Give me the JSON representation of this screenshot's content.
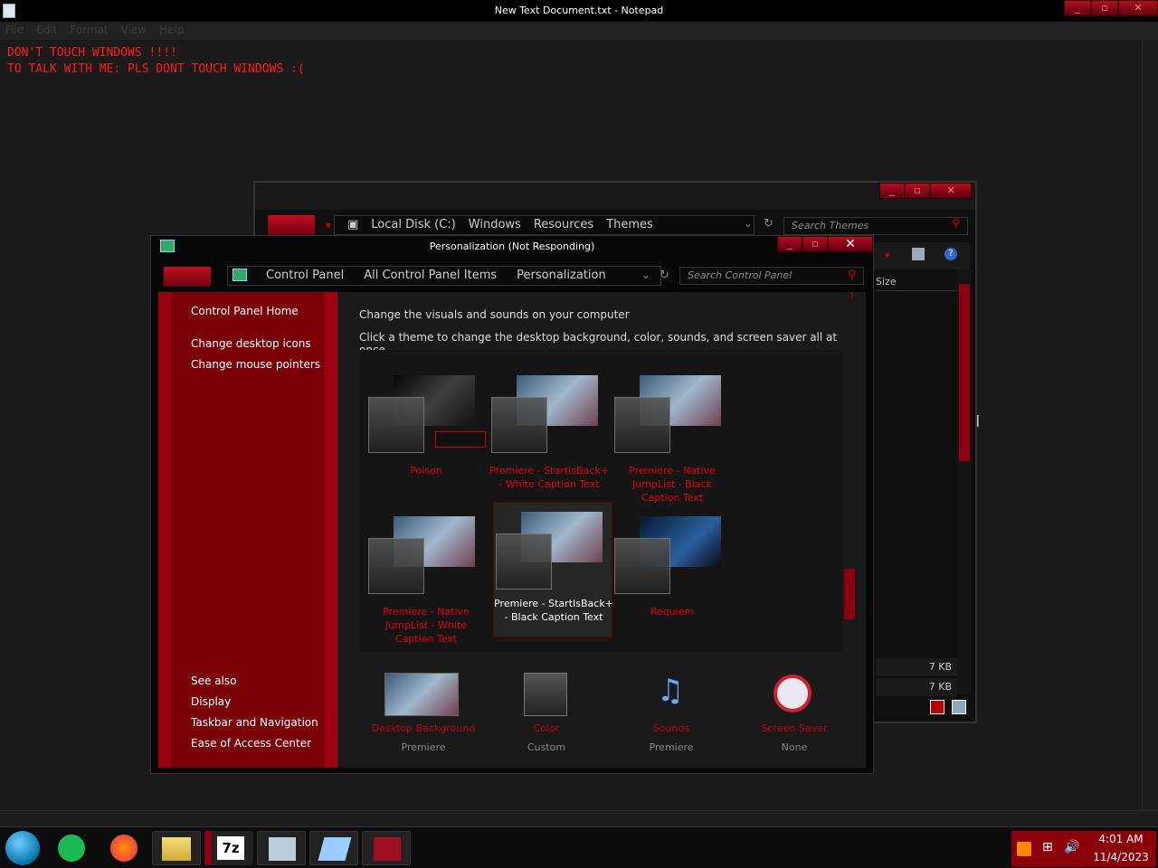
{
  "notepad": {
    "title": "New Text Document.txt - Notepad",
    "menu": [
      "File",
      "Edit",
      "Format",
      "View",
      "Help"
    ],
    "lines": [
      "DON'T TOUCH WINDOWS !!!!",
      "TO TALK WITH ME: PLS DONT TOUCH WINDOWS :("
    ]
  },
  "explorer": {
    "breadcrumb": [
      "Local Disk (C:)",
      "Windows",
      "Resources",
      "Themes"
    ],
    "search_placeholder": "Search Themes",
    "size_header": "Size",
    "sizes": [
      "7 KB",
      "7 KB"
    ]
  },
  "personalization": {
    "title": "Personalization (Not Responding)",
    "breadcrumb": [
      "Control Panel",
      "All Control Panel Items",
      "Personalization"
    ],
    "search_placeholder": "Search Control Panel",
    "sidebar": {
      "home": "Control Panel Home",
      "links": [
        "Change desktop icons",
        "Change mouse pointers"
      ],
      "see_also": "See also",
      "see_also_links": [
        "Display",
        "Taskbar and Navigation",
        "Ease of Access Center"
      ]
    },
    "heading": "Change the visuals and sounds on your computer",
    "subheading": "Click a theme to change the desktop background, color, sounds, and screen saver all at once.",
    "themes": [
      {
        "name": "Poison"
      },
      {
        "name": "Premiere - StartIsBack+ - White Caption Text"
      },
      {
        "name": "Premiere - Native JumpList - Black Caption Text"
      },
      {
        "name": "Premiere - Native JumpList - White Caption Text"
      },
      {
        "name": "Premiere - StartIsBack+ - Black Caption Text"
      },
      {
        "name": "Requiem"
      }
    ],
    "bottom": [
      {
        "label": "Desktop Background",
        "value": "Premiere"
      },
      {
        "label": "Color",
        "value": "Custom"
      },
      {
        "label": "Sounds",
        "value": "Premiere"
      },
      {
        "label": "Screen Saver",
        "value": "None"
      }
    ]
  },
  "taskbar": {
    "time": "4:01 AM",
    "date": "11/4/2023"
  },
  "colors": {
    "accent": "#8b0010",
    "text_red": "#e00010"
  }
}
